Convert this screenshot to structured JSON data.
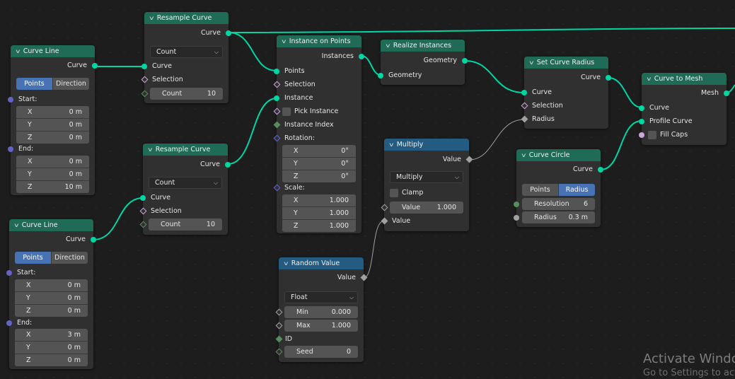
{
  "nodes": {
    "curve_line_1": {
      "title": "Curve Line",
      "output": "Curve",
      "mode_options": [
        "Points",
        "Direction"
      ],
      "mode_selected": "Points",
      "start_label": "Start:",
      "start": [
        {
          "axis": "X",
          "value": "0 m"
        },
        {
          "axis": "Y",
          "value": "0 m"
        },
        {
          "axis": "Z",
          "value": "0 m"
        }
      ],
      "end_label": "End:",
      "end": [
        {
          "axis": "X",
          "value": "0 m"
        },
        {
          "axis": "Y",
          "value": "0 m"
        },
        {
          "axis": "Z",
          "value": "10 m"
        }
      ]
    },
    "curve_line_2": {
      "title": "Curve Line",
      "output": "Curve",
      "mode_options": [
        "Points",
        "Direction"
      ],
      "mode_selected": "Points",
      "start_label": "Start:",
      "start": [
        {
          "axis": "X",
          "value": "0 m"
        },
        {
          "axis": "Y",
          "value": "0 m"
        },
        {
          "axis": "Z",
          "value": "0 m"
        }
      ],
      "end_label": "End:",
      "end": [
        {
          "axis": "X",
          "value": "3 m"
        },
        {
          "axis": "Y",
          "value": "0 m"
        },
        {
          "axis": "Z",
          "value": "0 m"
        }
      ]
    },
    "resample_1": {
      "title": "Resample Curve",
      "output": "Curve",
      "mode": "Count",
      "inputs": [
        "Curve",
        "Selection"
      ],
      "count_label": "Count",
      "count_value": "10"
    },
    "resample_2": {
      "title": "Resample Curve",
      "output": "Curve",
      "mode": "Count",
      "inputs": [
        "Curve",
        "Selection"
      ],
      "count_label": "Count",
      "count_value": "10"
    },
    "instance_on_points": {
      "title": "Instance on Points",
      "output": "Instances",
      "inputs": [
        "Points",
        "Selection",
        "Instance",
        "Pick Instance",
        "Instance Index"
      ],
      "rotation_label": "Rotation:",
      "rotation": [
        {
          "axis": "X",
          "value": "0°"
        },
        {
          "axis": "Y",
          "value": "0°"
        },
        {
          "axis": "Z",
          "value": "0°"
        }
      ],
      "scale_label": "Scale:",
      "scale": [
        {
          "axis": "X",
          "value": "1.000"
        },
        {
          "axis": "Y",
          "value": "1.000"
        },
        {
          "axis": "Z",
          "value": "1.000"
        }
      ]
    },
    "realize_instances": {
      "title": "Realize Instances",
      "output": "Geometry",
      "input": "Geometry"
    },
    "multiply": {
      "title": "Multiply",
      "output": "Value",
      "operation": "Multiply",
      "clamp_label": "Clamp",
      "value1_label": "Value",
      "value1": "1.000",
      "value2_label": "Value"
    },
    "random_value": {
      "title": "Random Value",
      "output": "Value",
      "data_type": "Float",
      "min_label": "Min",
      "min": "0.000",
      "max_label": "Max",
      "max": "1.000",
      "id_label": "ID",
      "seed_label": "Seed",
      "seed": "0"
    },
    "set_curve_radius": {
      "title": "Set Curve Radius",
      "output": "Curve",
      "inputs": [
        "Curve",
        "Selection",
        "Radius"
      ]
    },
    "curve_circle": {
      "title": "Curve Circle",
      "output": "Curve",
      "mode_options": [
        "Points",
        "Radius"
      ],
      "mode_selected": "Radius",
      "resolution_label": "Resolution",
      "resolution": "6",
      "radius_label": "Radius",
      "radius": "0.3 m"
    },
    "curve_to_mesh": {
      "title": "Curve to Mesh",
      "output": "Mesh",
      "inputs": [
        "Curve",
        "Profile Curve",
        "Fill Caps"
      ]
    }
  },
  "watermark": {
    "line1": "Activate Windows",
    "line2": "Go to Settings to activate Windows."
  },
  "colors": {
    "geometry_socket": "#00d6a3",
    "vector_socket": "#6363c7",
    "float_socket": "#a1a1a1",
    "int_socket": "#598c5c",
    "bool_socket": "#cca6d6",
    "geometry_header": "#1f6b56",
    "utility_header": "#235c80",
    "active_toggle": "#4772b3"
  }
}
